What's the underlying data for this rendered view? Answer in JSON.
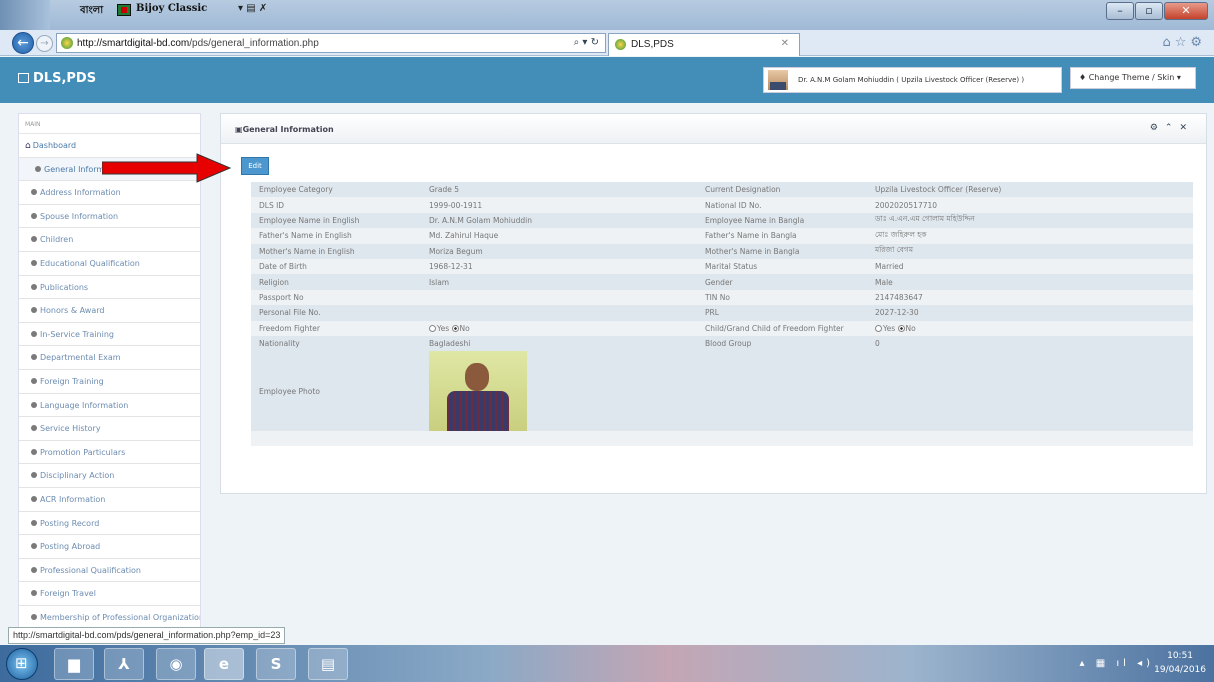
{
  "browser": {
    "lang_bar": {
      "keyboard_label": "বাংলা",
      "font_name": "Bijoy Classic"
    },
    "url": "http://smartdigital-bd.com/pds/general_information.php",
    "url_host": "http://smartdigital-bd.com",
    "url_path": "/pds/general_information.php",
    "tab_title": "DLS,PDS",
    "status_link": "http://smartdigital-bd.com/pds/general_information.php?emp_id=23"
  },
  "header": {
    "brand": "DLS,PDS",
    "user_name": "Dr. A.N.M Golam Mohiuddin ( Upzila Livestock Officer (Reserve) )",
    "theme_button": "Change Theme / Skin"
  },
  "sidebar": {
    "heading": "MAIN",
    "items": [
      {
        "label": "Dashboard"
      },
      {
        "label": "General Information"
      },
      {
        "label": "Address Information"
      },
      {
        "label": "Spouse Information"
      },
      {
        "label": "Children"
      },
      {
        "label": "Educational Qualification"
      },
      {
        "label": "Publications"
      },
      {
        "label": "Honors & Award"
      },
      {
        "label": "In-Service Training"
      },
      {
        "label": "Departmental Exam"
      },
      {
        "label": "Foreign Training"
      },
      {
        "label": "Language Information"
      },
      {
        "label": "Service History"
      },
      {
        "label": "Promotion Particulars"
      },
      {
        "label": "Disciplinary Action"
      },
      {
        "label": "ACR Information"
      },
      {
        "label": "Posting Record"
      },
      {
        "label": "Posting Abroad"
      },
      {
        "label": "Professional Qualification"
      },
      {
        "label": "Foreign Travel"
      },
      {
        "label": "Membership of Professional Organization"
      }
    ]
  },
  "panel": {
    "title": "General Information",
    "edit_label": "Edit",
    "rows": [
      {
        "k1": "Employee Category",
        "v1": "Grade 5",
        "k2": "Current Designation",
        "v2": "Upzila Livestock Officer (Reserve)"
      },
      {
        "k1": "DLS ID",
        "v1": "1999-00-1911",
        "k2": "National ID No.",
        "v2": "2002020517710"
      },
      {
        "k1": "Employee Name in English",
        "v1": "Dr. A.N.M Golam Mohiuddin",
        "k2": "Employee Name in Bangla",
        "v2": "ডাঃ এ.এন.এম গোলাম মহিউদ্দিন"
      },
      {
        "k1": "Father's Name in English",
        "v1": "Md. Zahirul Haque",
        "k2": "Father's Name in Bangla",
        "v2": "মোঃ জহিরুল হক"
      },
      {
        "k1": "Mother's Name in English",
        "v1": "Moriza Begum",
        "k2": "Mother's Name in Bangla",
        "v2": "মরিজা বেগম"
      },
      {
        "k1": "Date of Birth",
        "v1": "1968-12-31",
        "k2": "Marital Status",
        "v2": "Married"
      },
      {
        "k1": "Religion",
        "v1": "Islam",
        "k2": "Gender",
        "v2": "Male"
      },
      {
        "k1": "Passport No",
        "v1": "",
        "k2": "TIN No",
        "v2": "2147483647"
      },
      {
        "k1": "Personal File No.",
        "v1": "",
        "k2": "PRL",
        "v2": "2027-12-30"
      },
      {
        "k1": "Freedom Fighter",
        "v1": "",
        "k2": "Child/Grand Child of Freedom Fighter",
        "v2": ""
      },
      {
        "k1": "Nationality",
        "v1": "Bagladeshi",
        "k2": "Blood Group",
        "v2": "0"
      }
    ],
    "radio_yes": "Yes",
    "radio_no": "No",
    "photo_label": "Employee Photo"
  },
  "taskbar": {
    "time": "10:51",
    "date": "19/04/2016"
  },
  "colors": {
    "header_bg": "#438eb9",
    "edit_button": "#4d97cf",
    "arrow": "#e60000"
  }
}
